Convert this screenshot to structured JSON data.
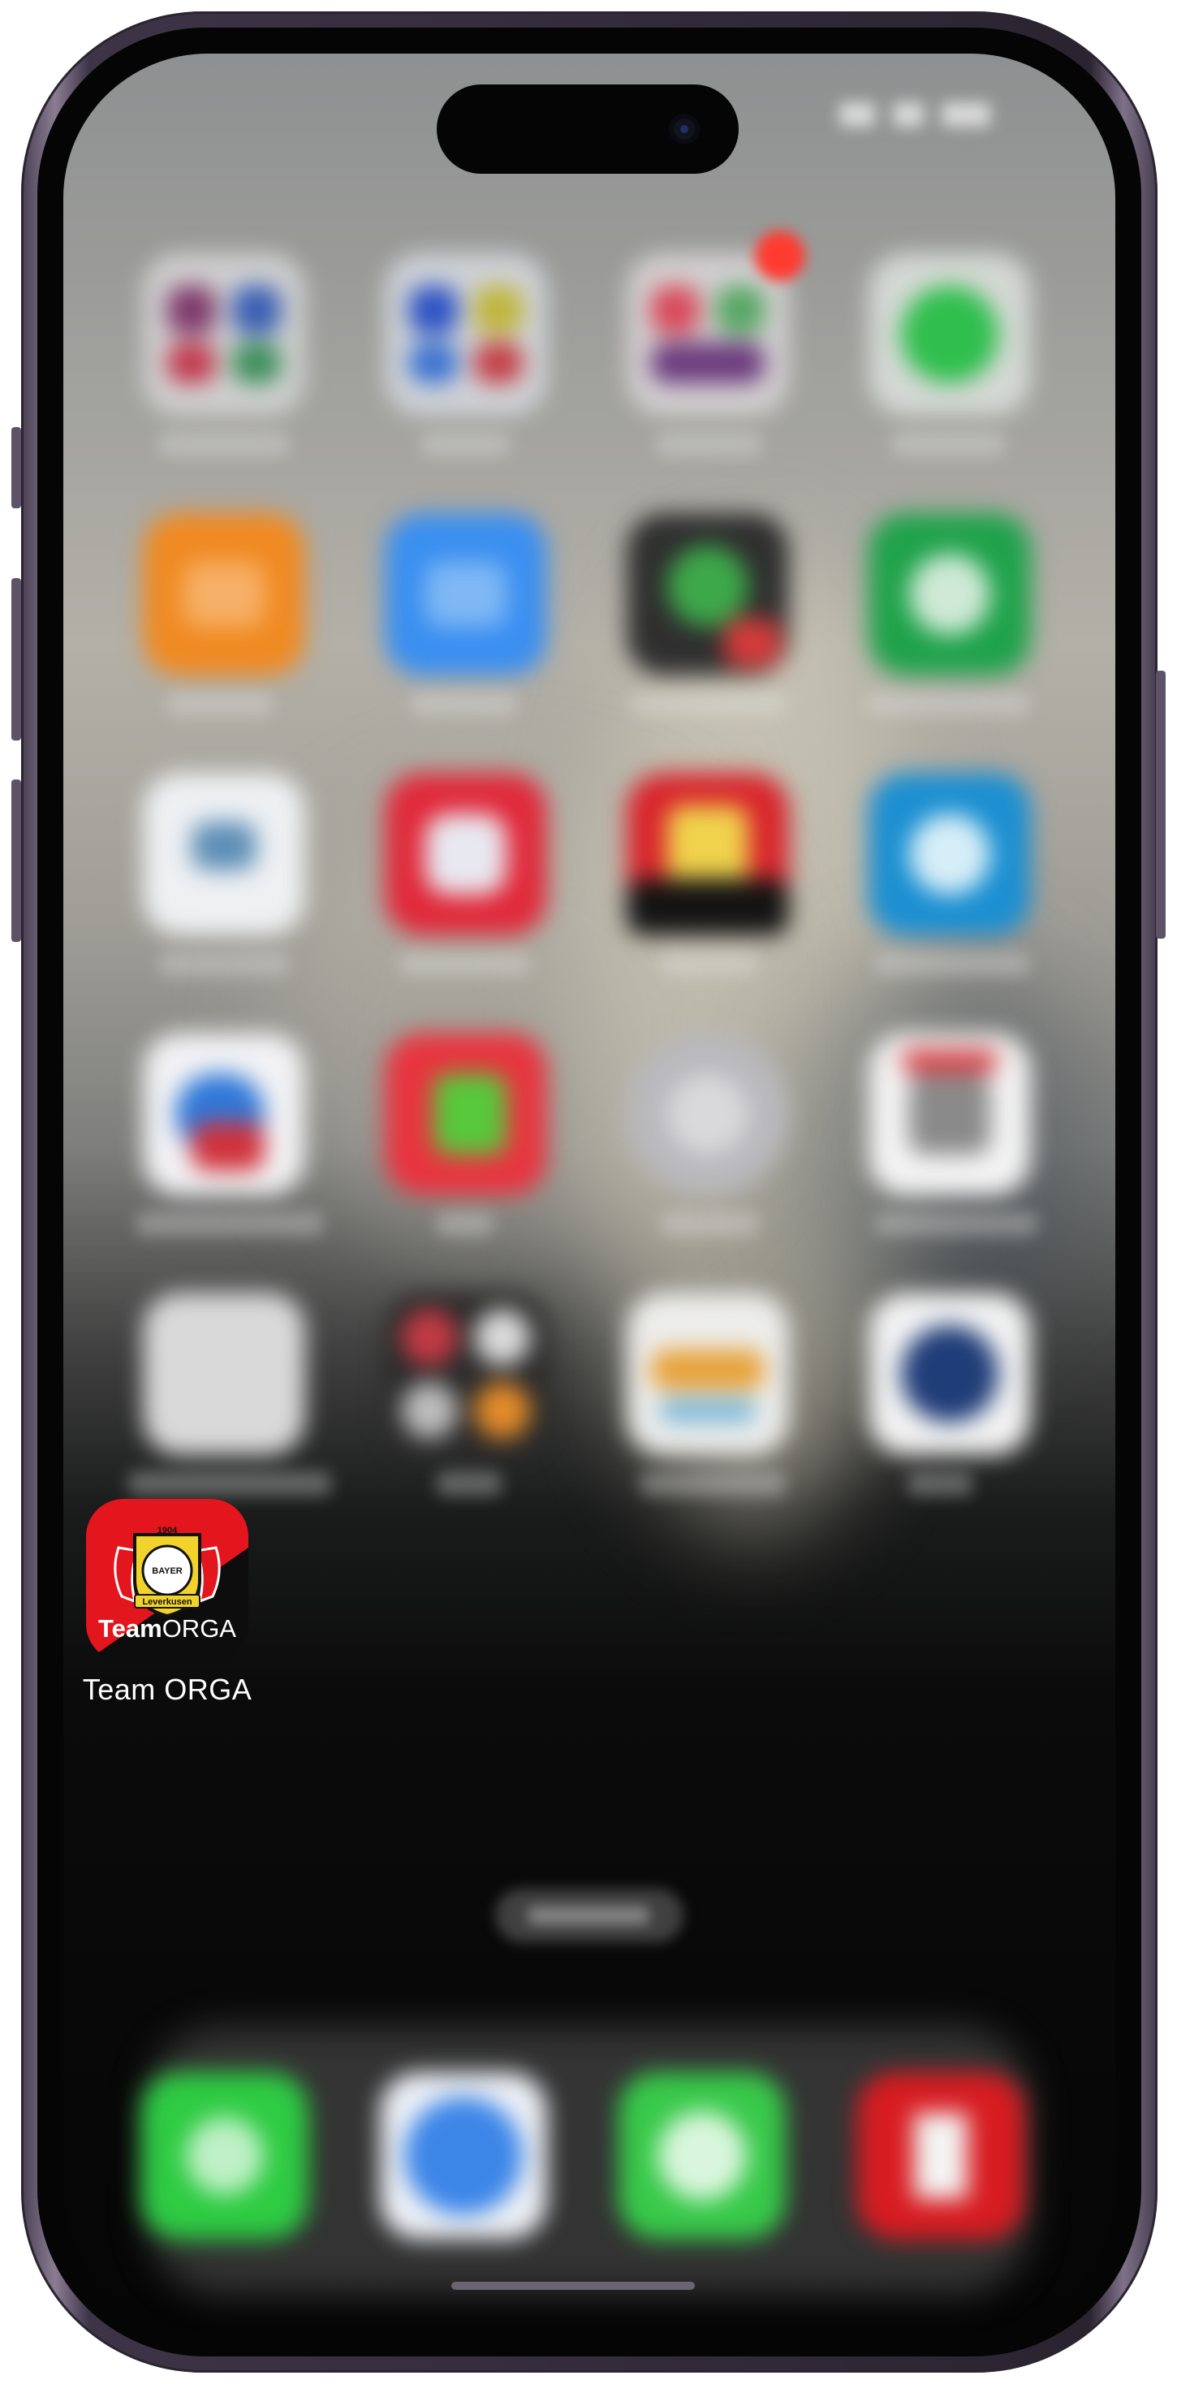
{
  "home_screen": {
    "apps": [
      {
        "name": "Team ORGA",
        "logo_top": "1904",
        "logo_ring_top": "BAYER",
        "logo_ring_bottom": "Leverkusen",
        "logo_word_bold": "Team",
        "logo_word_regular": "ORGA"
      }
    ]
  },
  "colors": {
    "accent_red": "#e3161d",
    "badge": "#ff3b30",
    "crest_yellow": "#f2d32b"
  },
  "icons": [
    "phone-icon",
    "safari-icon",
    "whatsapp-icon",
    "tesla-icon"
  ]
}
